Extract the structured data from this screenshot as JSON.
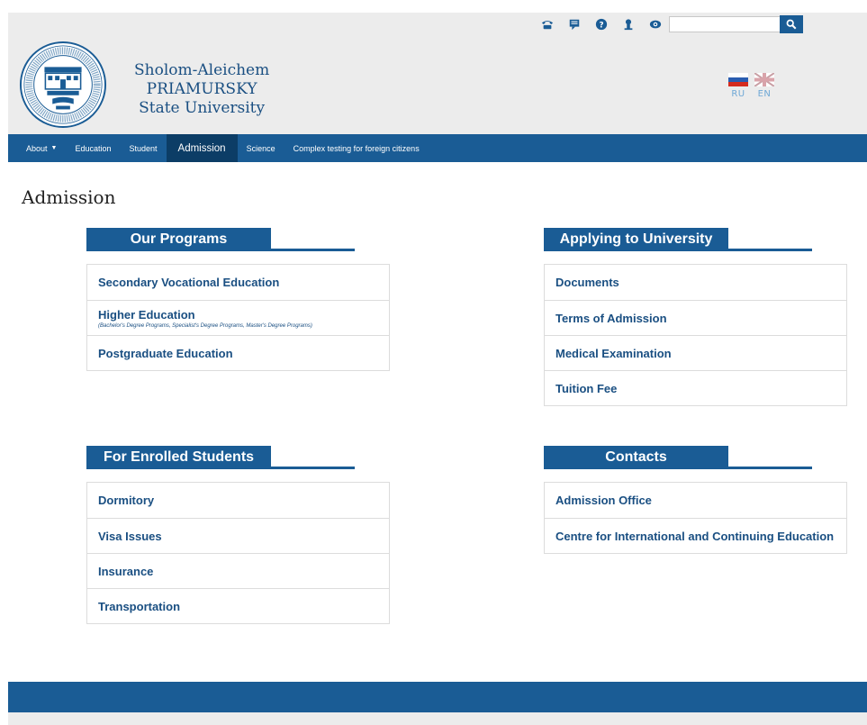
{
  "topbar": {
    "icons": [
      "phone-icon",
      "chat-icon",
      "help-icon",
      "user-icon",
      "eye-icon"
    ],
    "search": {
      "placeholder": "",
      "value": ""
    },
    "search_button_icon": "search-icon"
  },
  "header": {
    "brand_line1": "Sholom-Aleichem",
    "brand_line2": "PRIAMURSKY",
    "brand_line3": "State University",
    "languages": [
      {
        "code": "RU"
      },
      {
        "code": "EN"
      }
    ]
  },
  "nav": {
    "about": "About",
    "education": "Education",
    "student": "Student",
    "admission": "Admission",
    "science": "Science",
    "complex_testing": "Complex testing for foreign citizens"
  },
  "page": {
    "title": "Admission"
  },
  "sections": {
    "programs": {
      "title": "Our Programs",
      "items": [
        {
          "label": "Secondary Vocational Education"
        },
        {
          "label": "Higher Education",
          "sub": "(Bachelor's Degree Programs, Specialist's Degree Programs, Master's Degree Programs)"
        },
        {
          "label": "Postgraduate Education"
        }
      ]
    },
    "applying": {
      "title": "Applying to University",
      "items": [
        {
          "label": "Documents"
        },
        {
          "label": "Terms of Admission"
        },
        {
          "label": "Medical Examination"
        },
        {
          "label": "Tuition Fee"
        }
      ]
    },
    "enrolled": {
      "title": "For Enrolled Students",
      "items": [
        {
          "label": "Dormitory"
        },
        {
          "label": "Visa Issues"
        },
        {
          "label": "Insurance"
        },
        {
          "label": "Transportation"
        }
      ]
    },
    "contacts": {
      "title": "Contacts",
      "items": [
        {
          "label": "Admission Office"
        },
        {
          "label": "Centre for International and Continuing Education"
        }
      ]
    }
  },
  "colors": {
    "primary": "#1a5c95",
    "primary_dark": "#0c3d66",
    "header_bg": "#ececec",
    "link_text": "#1a4f82"
  }
}
